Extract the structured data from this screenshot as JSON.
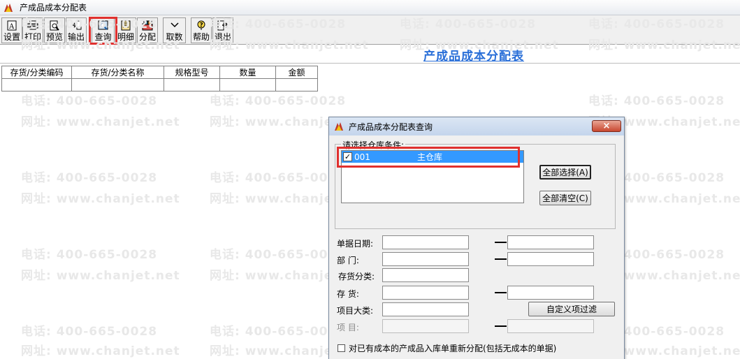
{
  "window": {
    "title": "产成品成本分配表"
  },
  "toolbar": [
    {
      "label": "设置",
      "icon": "settings-icon"
    },
    {
      "label": "打印",
      "icon": "print-icon"
    },
    {
      "label": "预览",
      "icon": "preview-icon"
    },
    {
      "label": "输出",
      "icon": "export-icon"
    },
    {
      "label": "查询",
      "icon": "query-icon"
    },
    {
      "label": "明细",
      "icon": "detail-icon"
    },
    {
      "label": "分配",
      "icon": "allocate-icon"
    },
    {
      "label": "取数",
      "icon": "fetch-data-icon"
    },
    {
      "label": "帮助",
      "icon": "help-icon"
    },
    {
      "label": "退出",
      "icon": "exit-icon"
    }
  ],
  "report": {
    "title": "产成品成本分配表",
    "columns": [
      "存货/分类编码",
      "存货/分类名称",
      "规格型号",
      "数量",
      "金额"
    ]
  },
  "watermark": {
    "phone": "电话: 400-665-0028",
    "site": "网址: www.chanjet.net"
  },
  "dialog": {
    "title": "产成品成本分配表查询",
    "close_glyph": "×",
    "group_label": "请选择仓库条件:",
    "warehouses": [
      {
        "code": "001",
        "name": "主仓库",
        "checked": true
      }
    ],
    "select_all": "全部选择(A)",
    "clear_all": "全部清空(C)",
    "fields": {
      "doc_date": "单据日期:",
      "department": "部    门:",
      "inventory_class": "存货分类:",
      "inventory": "存    货:",
      "project_class": "项目大类:",
      "project": "项    目:"
    },
    "custom_filter": "自定义项过滤",
    "realloc_option": "对已有成本的产成品入库单重新分配(包括无成本的单据)"
  },
  "colors": {
    "highlight": "#e0302e",
    "selection": "#3399ff",
    "title_link": "#2a6fd8"
  }
}
